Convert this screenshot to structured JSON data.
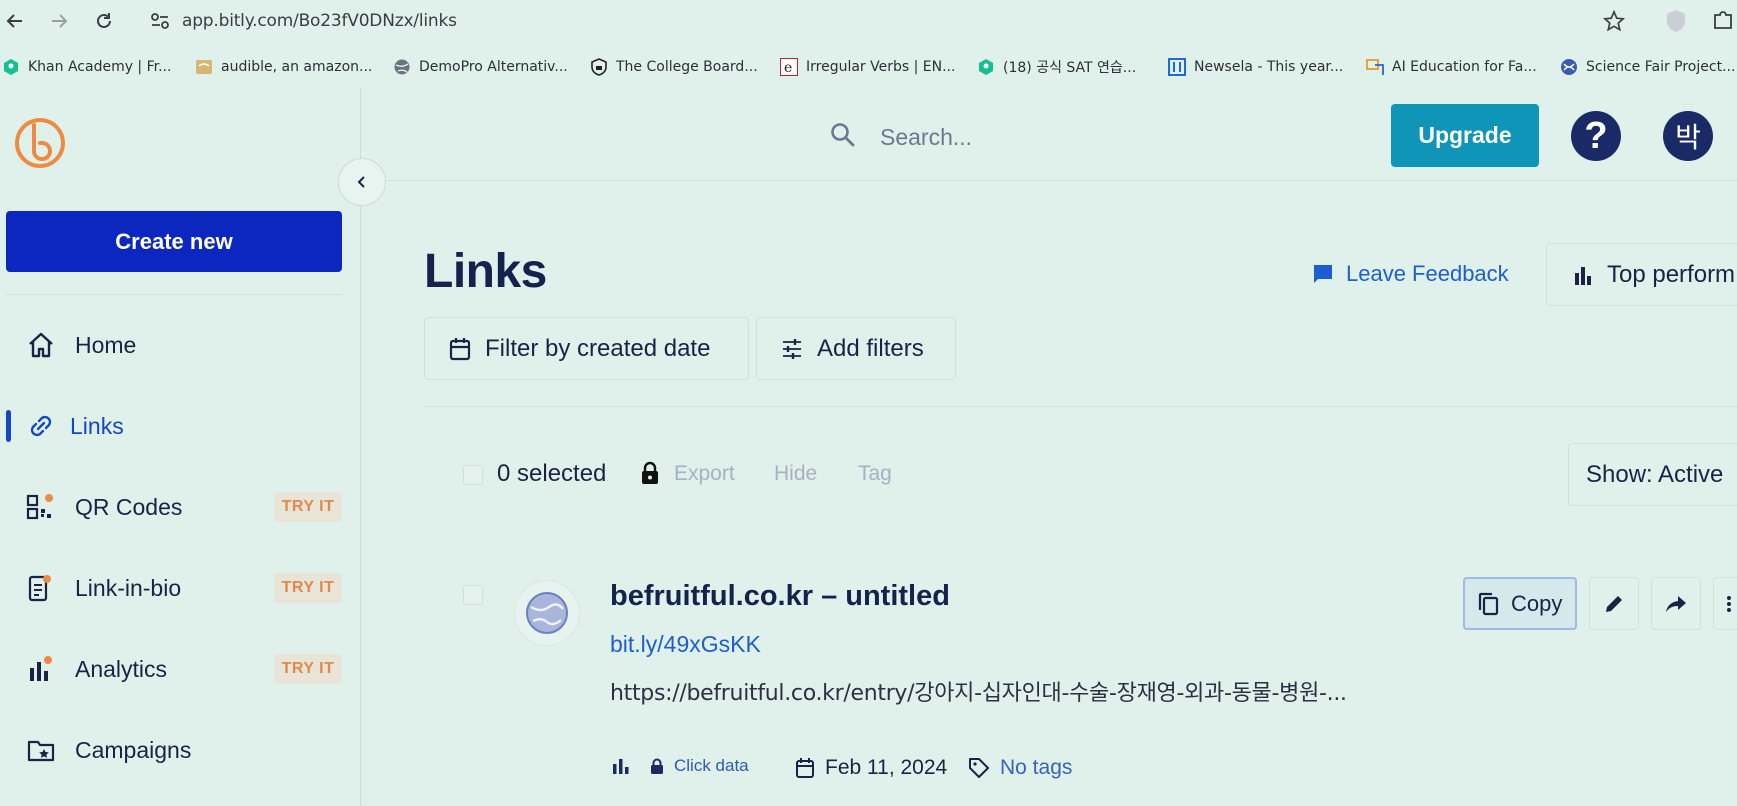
{
  "browser": {
    "url": "app.bitly.com/Bo23fV0DNzx/links",
    "bookmarks": [
      {
        "label": "Khan Academy | Fr...",
        "icon": "khan-academy-icon"
      },
      {
        "label": "audible, an amazon...",
        "icon": "audible-icon"
      },
      {
        "label": "DemoPro Alternativ...",
        "icon": "globe-icon"
      },
      {
        "label": "The College Board...",
        "icon": "college-board-icon"
      },
      {
        "label": "Irregular Verbs | EN...",
        "icon": "e-icon"
      },
      {
        "label": "(18) 공식 SAT 연습...",
        "icon": "khan-academy-icon"
      },
      {
        "label": "Newsela - This year...",
        "icon": "newsela-icon"
      },
      {
        "label": "AI Education for Fa...",
        "icon": "ai-education-icon"
      },
      {
        "label": "Science Fair Project...",
        "icon": "science-fair-icon"
      }
    ]
  },
  "header": {
    "search_placeholder": "Search...",
    "upgrade_label": "Upgrade",
    "help_label": "?",
    "avatar_initial": "박"
  },
  "sidebar": {
    "create_label": "Create new",
    "items": [
      {
        "label": "Home",
        "icon": "home-icon",
        "badge": ""
      },
      {
        "label": "Links",
        "icon": "link-icon",
        "badge": "",
        "active": true
      },
      {
        "label": "QR Codes",
        "icon": "qr-code-icon",
        "badge": "TRY IT"
      },
      {
        "label": "Link-in-bio",
        "icon": "link-in-bio-icon",
        "badge": "TRY IT"
      },
      {
        "label": "Analytics",
        "icon": "analytics-icon",
        "badge": "TRY IT"
      },
      {
        "label": "Campaigns",
        "icon": "campaigns-icon",
        "badge": ""
      }
    ]
  },
  "main": {
    "title": "Links",
    "leave_feedback": "Leave Feedback",
    "top_performing": "Top perform",
    "filters": {
      "created_date": "Filter by created date",
      "add_filters": "Add filters"
    },
    "toolbar": {
      "selected": "0 selected",
      "export": "Export",
      "hide": "Hide",
      "tag": "Tag",
      "show": "Show: Active"
    },
    "link": {
      "title": "befruitful.co.kr – untitled",
      "short": "bit.ly/49xGsKK",
      "long": "https://befruitful.co.kr/entry/강아지-십자인대-수술-장재영-외과-동물-병원-...",
      "copy_label": "Copy",
      "click_data": "Click data",
      "date": "Feb 11, 2024",
      "tags": "No tags"
    }
  },
  "colors": {
    "background": "#dff1ea",
    "primary": "#0b27bf",
    "upgrade": "#0e95b8",
    "accent_link": "#1d5fd0",
    "badge_text": "#e08a4a",
    "logo": "#ee8a42"
  }
}
